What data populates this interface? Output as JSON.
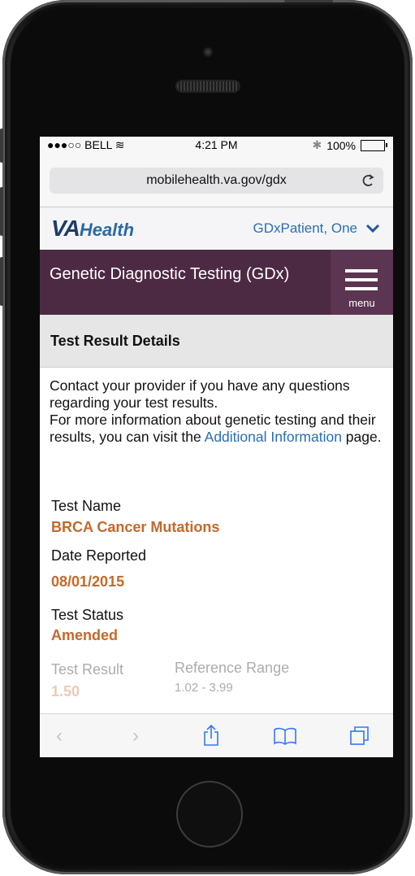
{
  "status": {
    "signal": "●●●○○ BELL",
    "wifi": "≋",
    "time": "4:21 PM",
    "bluetooth": "✱",
    "battery": "100%"
  },
  "browser": {
    "url": "mobilehealth.va.gov/gdx",
    "reload_icon": "C"
  },
  "header": {
    "logo_va": "VA",
    "logo_health": "Health",
    "user_name": "GDxPatient, One"
  },
  "titlebar": {
    "title": "Genetic Diagnostic Testing (GDx)",
    "menu_label": "menu"
  },
  "section": {
    "title": "Test Result Details"
  },
  "intro": {
    "line1": "Contact your provider if you have any questions regarding your test results.",
    "line2_before": "For more information about genetic testing and their results, you can visit the",
    "link": "Additional Information",
    "line2_after": " page."
  },
  "fields": {
    "test_name_label": "Test Name",
    "test_name_value": "BRCA Cancer Mutations",
    "date_label": "Date Reported",
    "date_value": "08/01/2015",
    "status_label": "Test Status",
    "status_value": "Amended",
    "result_label": "Test Result",
    "result_value": "1.50",
    "reference_label": "Reference Range",
    "reference_value": "1.02 - 3.99"
  },
  "toolbar": {
    "back": "‹",
    "forward": "›"
  },
  "colors": {
    "accent": "#4d2a43",
    "value": "#c4692a",
    "link": "#2a6fae",
    "ios_blue": "#3478f6"
  }
}
